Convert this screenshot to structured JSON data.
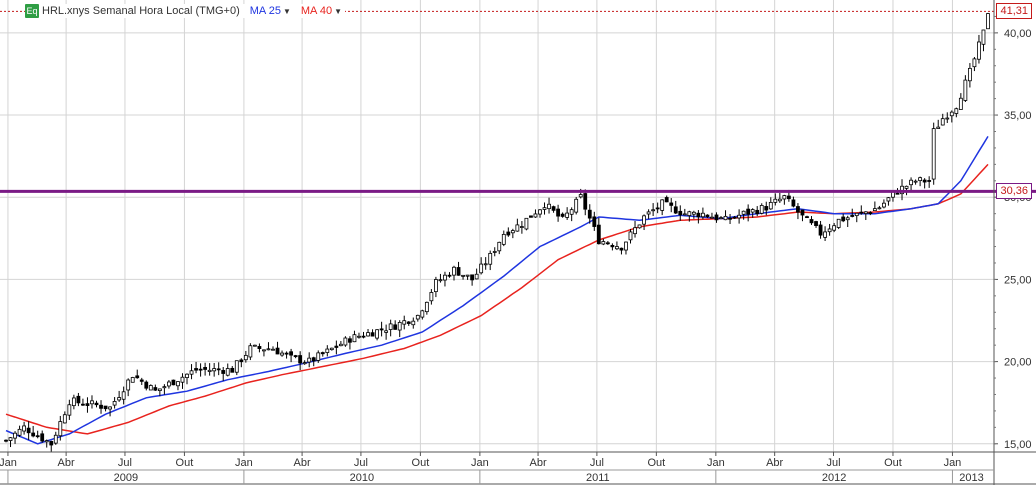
{
  "legend": {
    "symbol_badge": "Eq",
    "title": "HRL.xnys Semanal Hora Local (TMG+0)",
    "ma_short_label": "MA 25",
    "ma_long_label": "MA 40",
    "ma_short_color": "#1f35e0",
    "ma_long_color": "#e8231e",
    "candle_color": "#000000"
  },
  "price_markers": {
    "last_price": "41,31",
    "last_price_color": "#c41a1a",
    "resistance_label": "30,36",
    "resistance_color": "#7a1a85"
  },
  "chart_data": {
    "type": "candlestick",
    "x_unit": "week",
    "x_start": "2008-12-29",
    "x_end": "2013-02-25",
    "ylim": [
      14.5,
      42
    ],
    "y_ticks": [
      15,
      20,
      25,
      30,
      35,
      40
    ],
    "y_tick_labels": [
      "15,00",
      "20,00",
      "25,00",
      "30,00",
      "35,00",
      "40,00"
    ],
    "month_ticks": [
      {
        "label": "Jan",
        "date": "2009-01-01"
      },
      {
        "label": "Abr",
        "date": "2009-04-01"
      },
      {
        "label": "Jul",
        "date": "2009-07-01"
      },
      {
        "label": "Out",
        "date": "2009-10-01"
      },
      {
        "label": "Jan",
        "date": "2010-01-01"
      },
      {
        "label": "Abr",
        "date": "2010-04-01"
      },
      {
        "label": "Jul",
        "date": "2010-07-01"
      },
      {
        "label": "Out",
        "date": "2010-10-01"
      },
      {
        "label": "Jan",
        "date": "2011-01-01"
      },
      {
        "label": "Abr",
        "date": "2011-04-01"
      },
      {
        "label": "Jul",
        "date": "2011-07-01"
      },
      {
        "label": "Out",
        "date": "2011-10-01"
      },
      {
        "label": "Jan",
        "date": "2012-01-01"
      },
      {
        "label": "Abr",
        "date": "2012-04-01"
      },
      {
        "label": "Jul",
        "date": "2012-07-01"
      },
      {
        "label": "Out",
        "date": "2012-10-01"
      },
      {
        "label": "Jan",
        "date": "2013-01-01"
      }
    ],
    "years": [
      {
        "label": "2009",
        "start": "2009-01-01",
        "end": "2010-01-01"
      },
      {
        "label": "2010",
        "start": "2010-01-01",
        "end": "2011-01-01"
      },
      {
        "label": "2011",
        "start": "2011-01-01",
        "end": "2012-01-01"
      },
      {
        "label": "2012",
        "start": "2012-01-01",
        "end": "2013-01-01"
      },
      {
        "label": "2013",
        "start": "2013-01-01",
        "end": "2013-03-01"
      }
    ],
    "resistance_level": 30.36,
    "last_price": 41.31,
    "grid": true,
    "close_anchors": [
      {
        "date": "2008-12-29",
        "close": 15.2
      },
      {
        "date": "2009-01-26",
        "close": 16.0
      },
      {
        "date": "2009-03-09",
        "close": 15.0
      },
      {
        "date": "2009-04-06",
        "close": 17.6
      },
      {
        "date": "2009-05-11",
        "close": 17.4
      },
      {
        "date": "2009-06-08",
        "close": 17.2
      },
      {
        "date": "2009-07-13",
        "close": 19.2
      },
      {
        "date": "2009-08-17",
        "close": 18.2
      },
      {
        "date": "2009-09-14",
        "close": 18.8
      },
      {
        "date": "2009-10-19",
        "close": 19.5
      },
      {
        "date": "2009-12-14",
        "close": 19.5
      },
      {
        "date": "2010-01-11",
        "close": 20.8
      },
      {
        "date": "2010-02-15",
        "close": 20.8
      },
      {
        "date": "2010-03-15",
        "close": 20.2
      },
      {
        "date": "2010-04-12",
        "close": 20.0
      },
      {
        "date": "2010-05-10",
        "close": 20.6
      },
      {
        "date": "2010-06-14",
        "close": 21.4
      },
      {
        "date": "2010-07-19",
        "close": 21.8
      },
      {
        "date": "2010-08-23",
        "close": 22.2
      },
      {
        "date": "2010-09-27",
        "close": 22.8
      },
      {
        "date": "2010-10-25",
        "close": 24.8
      },
      {
        "date": "2010-11-22",
        "close": 25.6
      },
      {
        "date": "2010-12-20",
        "close": 25.0
      },
      {
        "date": "2011-01-17",
        "close": 26.4
      },
      {
        "date": "2011-02-07",
        "close": 27.8
      },
      {
        "date": "2011-03-07",
        "close": 28.4
      },
      {
        "date": "2011-04-11",
        "close": 29.6
      },
      {
        "date": "2011-05-09",
        "close": 28.6
      },
      {
        "date": "2011-06-06",
        "close": 30.0
      },
      {
        "date": "2011-07-04",
        "close": 27.4
      },
      {
        "date": "2011-08-08",
        "close": 27.0
      },
      {
        "date": "2011-09-12",
        "close": 28.8
      },
      {
        "date": "2011-10-10",
        "close": 29.6
      },
      {
        "date": "2011-11-14",
        "close": 29.0
      },
      {
        "date": "2011-12-12",
        "close": 29.0
      },
      {
        "date": "2012-01-16",
        "close": 28.6
      },
      {
        "date": "2012-02-13",
        "close": 29.0
      },
      {
        "date": "2012-03-19",
        "close": 29.4
      },
      {
        "date": "2012-04-16",
        "close": 30.0
      },
      {
        "date": "2012-05-14",
        "close": 28.8
      },
      {
        "date": "2012-06-11",
        "close": 27.8
      },
      {
        "date": "2012-07-09",
        "close": 28.6
      },
      {
        "date": "2012-08-13",
        "close": 29.0
      },
      {
        "date": "2012-09-10",
        "close": 29.4
      },
      {
        "date": "2012-10-08",
        "close": 30.4
      },
      {
        "date": "2012-11-05",
        "close": 31.0
      },
      {
        "date": "2012-11-26",
        "close": 31.0
      },
      {
        "date": "2012-12-03",
        "close": 34.0
      },
      {
        "date": "2012-12-17",
        "close": 34.8
      },
      {
        "date": "2013-01-07",
        "close": 35.6
      },
      {
        "date": "2013-01-28",
        "close": 37.6
      },
      {
        "date": "2013-02-18",
        "close": 40.0
      },
      {
        "date": "2013-02-25",
        "close": 41.3
      }
    ],
    "ma25_anchors": [
      {
        "date": "2008-12-29",
        "value": 15.8
      },
      {
        "date": "2009-02-16",
        "value": 15.0
      },
      {
        "date": "2009-04-06",
        "value": 15.6
      },
      {
        "date": "2009-06-01",
        "value": 16.8
      },
      {
        "date": "2009-08-03",
        "value": 17.8
      },
      {
        "date": "2009-10-05",
        "value": 18.2
      },
      {
        "date": "2009-12-07",
        "value": 18.9
      },
      {
        "date": "2010-02-08",
        "value": 19.4
      },
      {
        "date": "2010-04-05",
        "value": 19.9
      },
      {
        "date": "2010-06-07",
        "value": 20.5
      },
      {
        "date": "2010-08-02",
        "value": 21.0
      },
      {
        "date": "2010-10-04",
        "value": 21.8
      },
      {
        "date": "2010-12-06",
        "value": 23.4
      },
      {
        "date": "2011-02-07",
        "value": 25.2
      },
      {
        "date": "2011-04-04",
        "value": 27.0
      },
      {
        "date": "2011-06-06",
        "value": 28.2
      },
      {
        "date": "2011-07-04",
        "value": 28.8
      },
      {
        "date": "2011-09-05",
        "value": 28.6
      },
      {
        "date": "2011-11-07",
        "value": 28.9
      },
      {
        "date": "2012-01-09",
        "value": 28.7
      },
      {
        "date": "2012-03-05",
        "value": 29.0
      },
      {
        "date": "2012-05-07",
        "value": 29.3
      },
      {
        "date": "2012-07-02",
        "value": 29.0
      },
      {
        "date": "2012-09-03",
        "value": 29.0
      },
      {
        "date": "2012-10-29",
        "value": 29.3
      },
      {
        "date": "2012-12-10",
        "value": 29.6
      },
      {
        "date": "2013-01-14",
        "value": 31.0
      },
      {
        "date": "2013-02-25",
        "value": 33.7
      }
    ],
    "ma40_anchors": [
      {
        "date": "2008-12-29",
        "value": 16.8
      },
      {
        "date": "2009-03-02",
        "value": 16.0
      },
      {
        "date": "2009-05-04",
        "value": 15.6
      },
      {
        "date": "2009-07-06",
        "value": 16.3
      },
      {
        "date": "2009-09-07",
        "value": 17.3
      },
      {
        "date": "2009-11-02",
        "value": 17.9
      },
      {
        "date": "2010-01-04",
        "value": 18.7
      },
      {
        "date": "2010-03-01",
        "value": 19.2
      },
      {
        "date": "2010-05-03",
        "value": 19.7
      },
      {
        "date": "2010-07-05",
        "value": 20.2
      },
      {
        "date": "2010-09-06",
        "value": 20.8
      },
      {
        "date": "2010-11-01",
        "value": 21.6
      },
      {
        "date": "2011-01-03",
        "value": 22.8
      },
      {
        "date": "2011-03-07",
        "value": 24.5
      },
      {
        "date": "2011-05-02",
        "value": 26.2
      },
      {
        "date": "2011-07-04",
        "value": 27.4
      },
      {
        "date": "2011-09-05",
        "value": 28.2
      },
      {
        "date": "2011-11-07",
        "value": 28.6
      },
      {
        "date": "2012-01-09",
        "value": 28.7
      },
      {
        "date": "2012-03-05",
        "value": 28.8
      },
      {
        "date": "2012-05-07",
        "value": 29.1
      },
      {
        "date": "2012-07-02",
        "value": 29.0
      },
      {
        "date": "2012-09-03",
        "value": 29.1
      },
      {
        "date": "2012-10-29",
        "value": 29.3
      },
      {
        "date": "2012-12-10",
        "value": 29.6
      },
      {
        "date": "2013-01-14",
        "value": 30.2
      },
      {
        "date": "2013-02-25",
        "value": 32.0
      }
    ]
  }
}
